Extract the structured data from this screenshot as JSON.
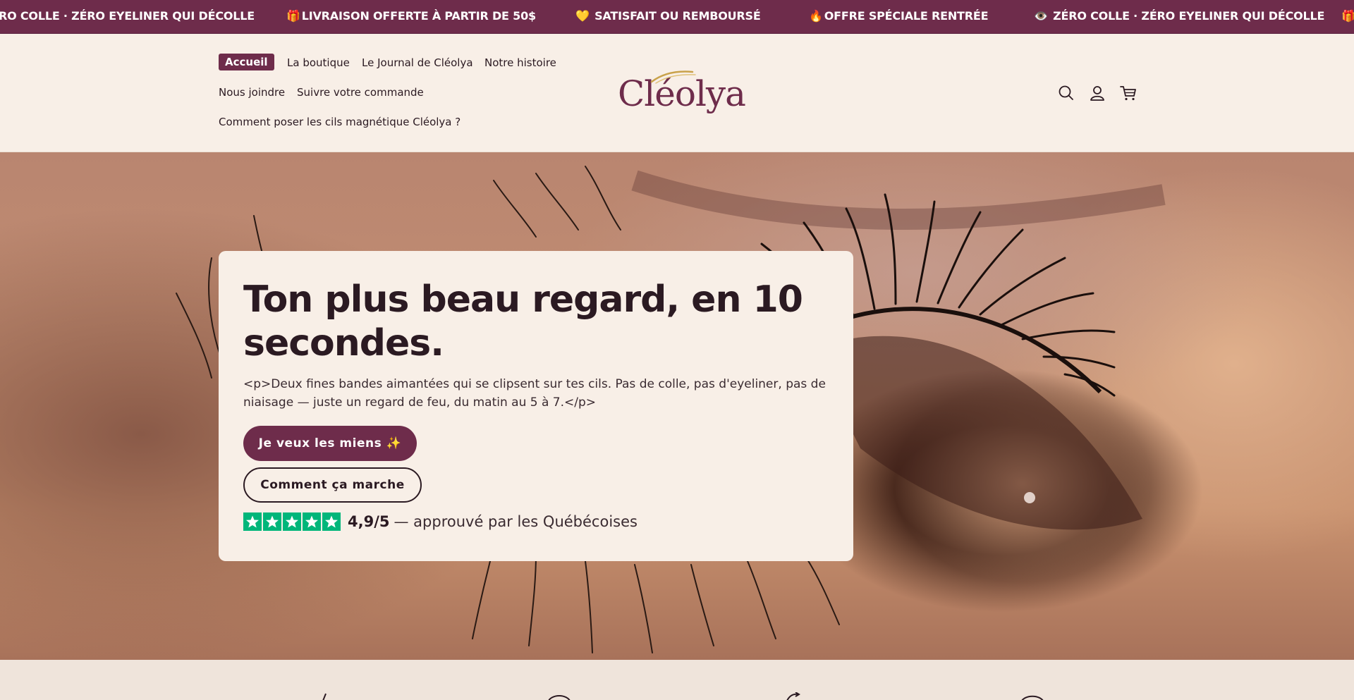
{
  "announcement": {
    "items": [
      {
        "emoji": "",
        "text": "RO COLLE · ZÉRO EYELINER QUI DÉCOLLE"
      },
      {
        "emoji": "🎁",
        "text": "LIVRAISON OFFERTE À PARTIR DE 50$"
      },
      {
        "emoji": "💛",
        "text": "SATISFAIT OU REMBOURSÉ"
      },
      {
        "emoji": "🔥",
        "text": "OFFRE SPÉCIALE RENTRÉE"
      },
      {
        "emoji": "👁️",
        "text": "ZÉRO COLLE · ZÉRO EYELINER QUI DÉCOLLE"
      },
      {
        "emoji": "🎁",
        "text": ""
      }
    ]
  },
  "nav": {
    "items": [
      "Accueil",
      "La boutique",
      "Le Journal de Cléolya",
      "Notre histoire",
      "Nous joindre",
      "Suivre votre commande",
      "Comment poser les cils magnétique Cléolya ?"
    ],
    "active_index": 0
  },
  "brand": {
    "logo_text": "Cléolya"
  },
  "header_icons": [
    "search-icon",
    "account-icon",
    "cart-icon"
  ],
  "hero": {
    "title": "Ton plus beau regard, en 10 secondes.",
    "description": "<p>Deux fines bandes aimantées qui se clipsent sur tes cils. Pas de colle, pas d'eyeliner, pas de niaisage — juste un regard de feu, du matin au 5 à 7.</p>",
    "primary_button": "Je veux les miens ✨",
    "secondary_button": "Comment ça marche",
    "rating": {
      "stars": 5,
      "score": "4,9/5",
      "text": "— approuvé par les Québécoises"
    }
  },
  "colors": {
    "brand": "#6e2c4b",
    "background": "#f8efe7",
    "text": "#2b1a22",
    "trustpilot": "#00b67a"
  }
}
